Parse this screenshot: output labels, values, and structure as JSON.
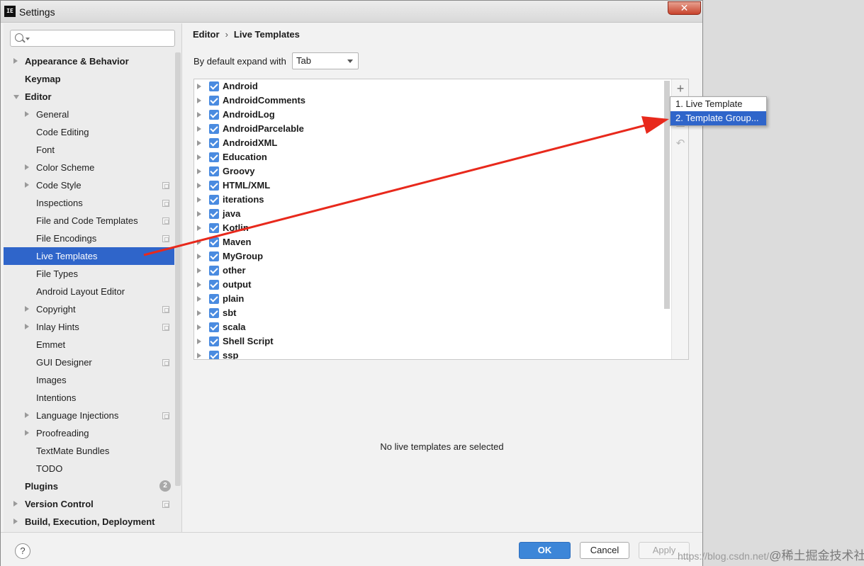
{
  "window": {
    "title": "Settings",
    "icon_label": "IE",
    "close_glyph": "✕"
  },
  "search": {
    "placeholder": ""
  },
  "sidebar": {
    "items": [
      {
        "label": "Appearance & Behavior",
        "bold": true,
        "level": 0,
        "expander": "collapsed",
        "project_icon": false
      },
      {
        "label": "Keymap",
        "bold": true,
        "level": 0,
        "expander": "none",
        "project_icon": false
      },
      {
        "label": "Editor",
        "bold": true,
        "level": 0,
        "expander": "expanded",
        "project_icon": false
      },
      {
        "label": "General",
        "bold": false,
        "level": 1,
        "expander": "collapsed",
        "project_icon": false
      },
      {
        "label": "Code Editing",
        "bold": false,
        "level": 1,
        "expander": "none",
        "project_icon": false
      },
      {
        "label": "Font",
        "bold": false,
        "level": 1,
        "expander": "none",
        "project_icon": false
      },
      {
        "label": "Color Scheme",
        "bold": false,
        "level": 1,
        "expander": "collapsed",
        "project_icon": false
      },
      {
        "label": "Code Style",
        "bold": false,
        "level": 1,
        "expander": "collapsed",
        "project_icon": true
      },
      {
        "label": "Inspections",
        "bold": false,
        "level": 1,
        "expander": "none",
        "project_icon": true
      },
      {
        "label": "File and Code Templates",
        "bold": false,
        "level": 1,
        "expander": "none",
        "project_icon": true
      },
      {
        "label": "File Encodings",
        "bold": false,
        "level": 1,
        "expander": "none",
        "project_icon": true
      },
      {
        "label": "Live Templates",
        "bold": false,
        "level": 1,
        "expander": "none",
        "project_icon": false,
        "selected": true
      },
      {
        "label": "File Types",
        "bold": false,
        "level": 1,
        "expander": "none",
        "project_icon": false
      },
      {
        "label": "Android Layout Editor",
        "bold": false,
        "level": 1,
        "expander": "none",
        "project_icon": false
      },
      {
        "label": "Copyright",
        "bold": false,
        "level": 1,
        "expander": "collapsed",
        "project_icon": true
      },
      {
        "label": "Inlay Hints",
        "bold": false,
        "level": 1,
        "expander": "collapsed",
        "project_icon": true
      },
      {
        "label": "Emmet",
        "bold": false,
        "level": 1,
        "expander": "none",
        "project_icon": false
      },
      {
        "label": "GUI Designer",
        "bold": false,
        "level": 1,
        "expander": "none",
        "project_icon": true
      },
      {
        "label": "Images",
        "bold": false,
        "level": 1,
        "expander": "none",
        "project_icon": false
      },
      {
        "label": "Intentions",
        "bold": false,
        "level": 1,
        "expander": "none",
        "project_icon": false
      },
      {
        "label": "Language Injections",
        "bold": false,
        "level": 1,
        "expander": "collapsed",
        "project_icon": true
      },
      {
        "label": "Proofreading",
        "bold": false,
        "level": 1,
        "expander": "collapsed",
        "project_icon": false
      },
      {
        "label": "TextMate Bundles",
        "bold": false,
        "level": 1,
        "expander": "none",
        "project_icon": false
      },
      {
        "label": "TODO",
        "bold": false,
        "level": 1,
        "expander": "none",
        "project_icon": false
      },
      {
        "label": "Plugins",
        "bold": true,
        "level": 0,
        "expander": "none",
        "project_icon": false,
        "badge": "2"
      },
      {
        "label": "Version Control",
        "bold": true,
        "level": 0,
        "expander": "collapsed",
        "project_icon": true
      },
      {
        "label": "Build, Execution, Deployment",
        "bold": true,
        "level": 0,
        "expander": "collapsed",
        "project_icon": false
      }
    ]
  },
  "breadcrumb": {
    "parent": "Editor",
    "separator": "›",
    "current": "Live Templates"
  },
  "expand": {
    "label": "By default expand with",
    "value": "Tab"
  },
  "templates": {
    "groups": [
      {
        "label": "Android",
        "checked": true
      },
      {
        "label": "AndroidComments",
        "checked": true
      },
      {
        "label": "AndroidLog",
        "checked": true
      },
      {
        "label": "AndroidParcelable",
        "checked": true
      },
      {
        "label": "AndroidXML",
        "checked": true
      },
      {
        "label": "Education",
        "checked": true
      },
      {
        "label": "Groovy",
        "checked": true
      },
      {
        "label": "HTML/XML",
        "checked": true
      },
      {
        "label": "iterations",
        "checked": true
      },
      {
        "label": "java",
        "checked": true
      },
      {
        "label": "Kotlin",
        "checked": true
      },
      {
        "label": "Maven",
        "checked": true
      },
      {
        "label": "MyGroup",
        "checked": true
      },
      {
        "label": "other",
        "checked": true
      },
      {
        "label": "output",
        "checked": true
      },
      {
        "label": "plain",
        "checked": true
      },
      {
        "label": "sbt",
        "checked": true
      },
      {
        "label": "scala",
        "checked": true
      },
      {
        "label": "Shell Script",
        "checked": true
      },
      {
        "label": "ssp",
        "checked": true
      }
    ],
    "toolbar": {
      "add_glyph": "+",
      "remove_glyph": "−",
      "copy_glyph": "▤",
      "restore_glyph": "↶"
    },
    "empty_message": "No live templates are selected"
  },
  "popup": {
    "items": [
      {
        "label": "1. Live Template",
        "selected": false
      },
      {
        "label": "2. Template Group...",
        "selected": true
      }
    ]
  },
  "footer": {
    "help_glyph": "?",
    "ok_label": "OK",
    "cancel_label": "Cancel",
    "apply_label": "Apply"
  },
  "watermark": {
    "text": "https://blog.csdn.net/",
    "brand": "@稀土掘金技术社区"
  },
  "colors": {
    "selection": "#2f65ca",
    "checkbox": "#4a8be0",
    "ok_button": "#3d86d8",
    "annotation_arrow": "#e8291c"
  }
}
